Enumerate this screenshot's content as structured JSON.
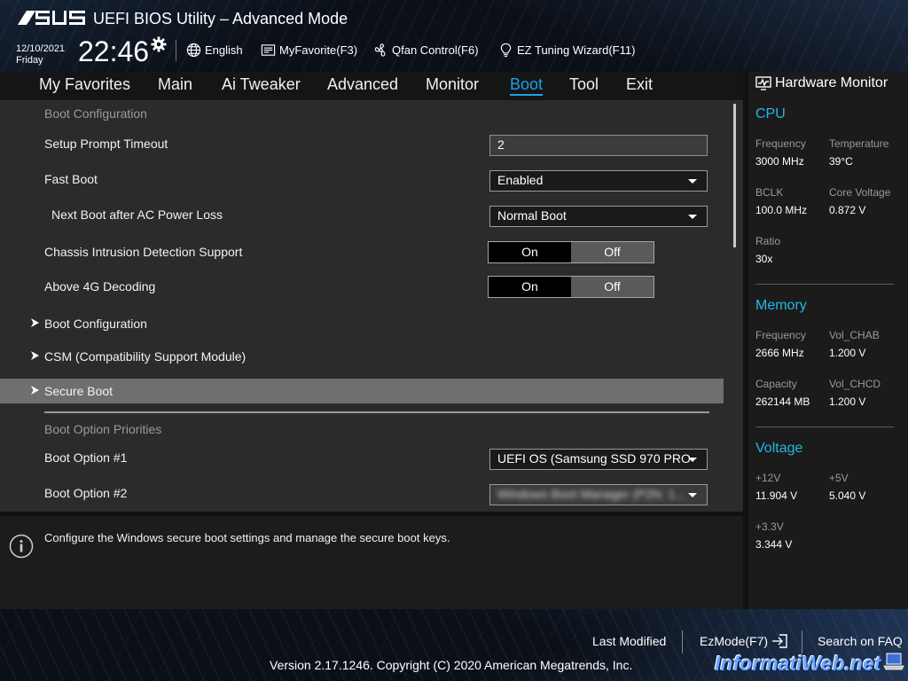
{
  "header": {
    "logo": "/ISUS",
    "title": "UEFI BIOS Utility – Advanced Mode",
    "date": "12/10/2021",
    "day": "Friday",
    "time": "22:46",
    "items": [
      {
        "label": "English",
        "icon": "globe-icon"
      },
      {
        "label": "MyFavorite(F3)",
        "icon": "favorite-icon"
      },
      {
        "label": "Qfan Control(F6)",
        "icon": "fan-icon"
      },
      {
        "label": "EZ Tuning Wizard(F11)",
        "icon": "lightbulb-icon"
      }
    ]
  },
  "tabs": [
    {
      "label": "My Favorites"
    },
    {
      "label": "Main"
    },
    {
      "label": "Ai Tweaker"
    },
    {
      "label": "Advanced"
    },
    {
      "label": "Monitor"
    },
    {
      "label": "Boot",
      "active": true
    },
    {
      "label": "Tool"
    },
    {
      "label": "Exit"
    }
  ],
  "main": {
    "section_boot_config": "Boot Configuration",
    "setup_prompt_timeout": {
      "label": "Setup Prompt Timeout",
      "value": "2"
    },
    "fast_boot": {
      "label": "Fast Boot",
      "value": "Enabled"
    },
    "next_boot_ac": {
      "label": "Next Boot after AC Power Loss",
      "value": "Normal Boot"
    },
    "chassis_intrusion": {
      "label": "Chassis Intrusion Detection Support",
      "on": "On",
      "off": "Off",
      "selected": "Off"
    },
    "above_4g": {
      "label": "Above 4G Decoding",
      "on": "On",
      "off": "Off",
      "selected": "Off"
    },
    "submenus": [
      {
        "label": "Boot Configuration"
      },
      {
        "label": "CSM (Compatibility Support Module)"
      },
      {
        "label": "Secure Boot",
        "selected": true
      }
    ],
    "section_boot_priorities": "Boot Option Priorities",
    "boot_option_1": {
      "label": "Boot Option #1",
      "value": "UEFI OS (Samsung SSD 970 PRO"
    },
    "boot_option_2": {
      "label": "Boot Option #2",
      "value": "Windows Boot Manager (P2N: 1..."
    }
  },
  "help": {
    "text": "Configure the Windows secure boot settings and manage the secure boot keys."
  },
  "hardware_monitor": {
    "title": "Hardware Monitor",
    "cpu": {
      "title": "CPU",
      "frequency_label": "Frequency",
      "frequency": "3000 MHz",
      "temperature_label": "Temperature",
      "temperature": "39°C",
      "bclk_label": "BCLK",
      "bclk": "100.0 MHz",
      "core_voltage_label": "Core Voltage",
      "core_voltage": "0.872 V",
      "ratio_label": "Ratio",
      "ratio": "30x"
    },
    "memory": {
      "title": "Memory",
      "frequency_label": "Frequency",
      "frequency": "2666 MHz",
      "vol_chab_label": "Vol_CHAB",
      "vol_chab": "1.200 V",
      "capacity_label": "Capacity",
      "capacity": "262144 MB",
      "vol_chcd_label": "Vol_CHCD",
      "vol_chcd": "1.200 V"
    },
    "voltage": {
      "title": "Voltage",
      "v12_label": "+12V",
      "v12": "11.904 V",
      "v5_label": "+5V",
      "v5": "5.040 V",
      "v33_label": "+3.3V",
      "v33": "3.344 V"
    }
  },
  "footer": {
    "last_modified": "Last Modified",
    "ezmode": "EzMode(F7)",
    "search_faq": "Search on FAQ",
    "copyright": "Version 2.17.1246. Copyright (C) 2020 American Megatrends, Inc.",
    "watermark": "InformatiWeb.net"
  },
  "colors": {
    "accent": "#1aa3e8",
    "monitor_section": "#22b8e8",
    "selected_row": "#6f6f6f",
    "panel_bg": "#2b2b2b"
  }
}
